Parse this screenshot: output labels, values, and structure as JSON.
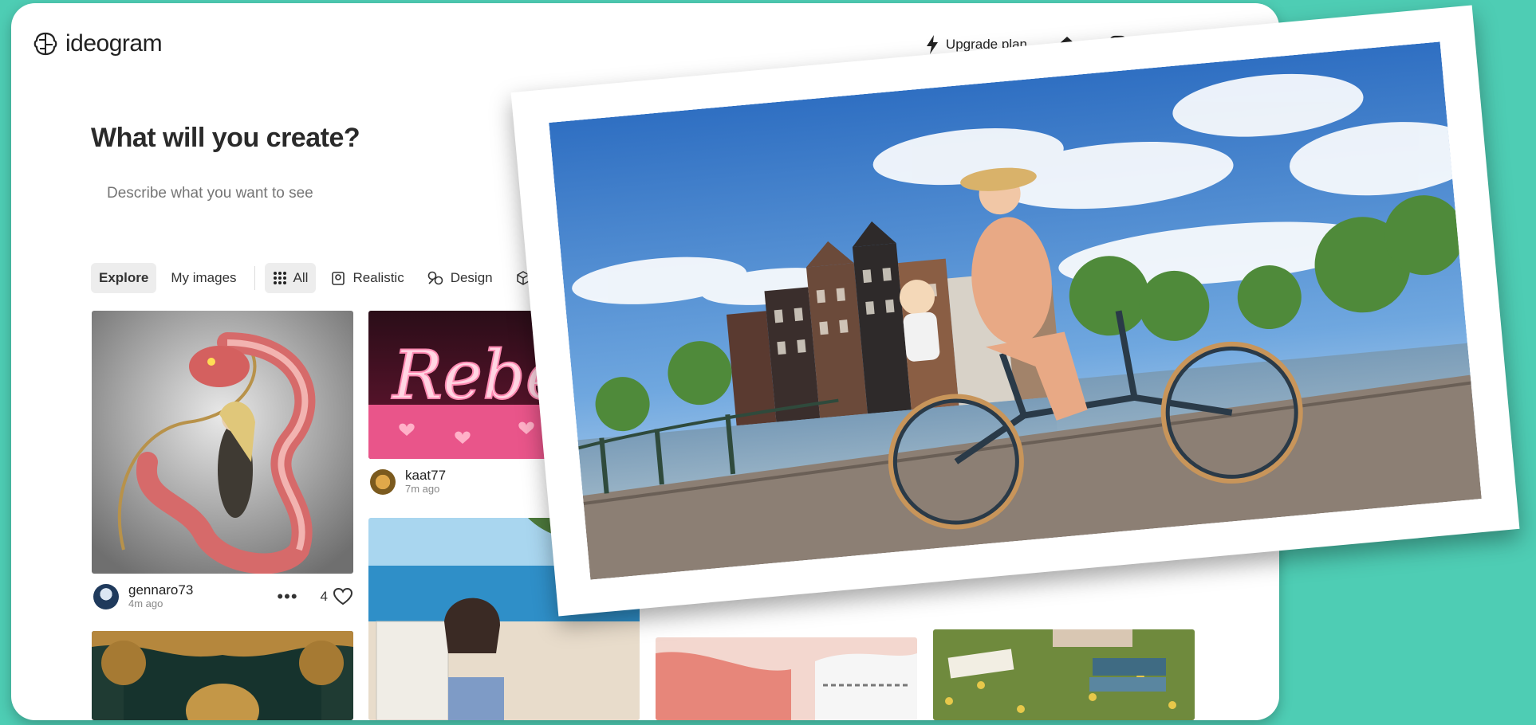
{
  "app": {
    "name": "ideogram"
  },
  "header": {
    "upgrade_label": "Upgrade plan",
    "icons": [
      "bolt-icon",
      "home-icon",
      "my-images-icon",
      "bell-icon",
      "menu-icon"
    ]
  },
  "create": {
    "heading": "What will you create?",
    "placeholder": "Describe what you want to see"
  },
  "tabs": [
    {
      "label": "Explore",
      "active": true
    },
    {
      "label": "My images",
      "active": false
    },
    {
      "label": "All",
      "icon": "grid-icon",
      "active": true
    },
    {
      "label": "Realistic",
      "icon": "realistic-icon"
    },
    {
      "label": "Design",
      "icon": "design-icon"
    }
  ],
  "feed": {
    "card1": {
      "user": "gennaro73",
      "ago": "4m ago",
      "likes": "4"
    },
    "card2": {
      "user": "kaat77",
      "ago": "7m ago",
      "image_text": "Rebecc"
    }
  },
  "colors": {
    "background": "#4ecdb4",
    "window": "#ffffff",
    "accent": "#222222"
  }
}
